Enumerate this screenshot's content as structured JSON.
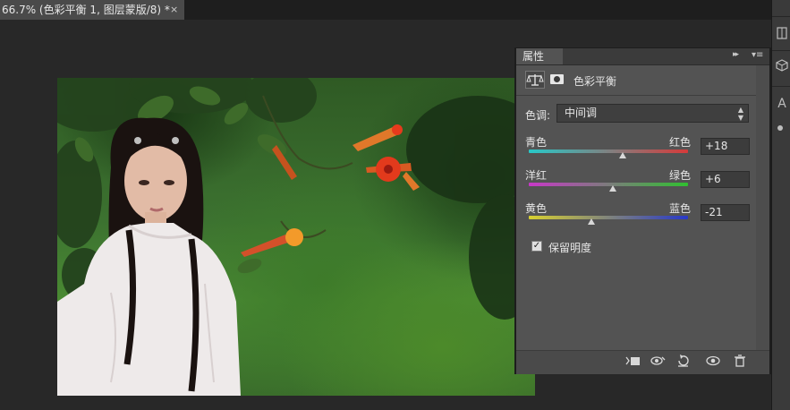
{
  "document_tab": {
    "title": "66.7% (色彩平衡 1, 图层蒙版/8) *",
    "close": "×"
  },
  "properties_panel": {
    "tab_label": "属性",
    "collapse_glyph": "▸▸",
    "menu_glyph": "▾≡",
    "adjustment_title": "色彩平衡",
    "tone_label": "色调:",
    "tone_value": "中间调",
    "sliders": [
      {
        "left": "青色",
        "right": "红色",
        "value": "+18",
        "fraction": 0.59,
        "gradient": [
          "#28c8c8",
          "#d63a3a"
        ]
      },
      {
        "left": "洋红",
        "right": "绿色",
        "value": "+6",
        "fraction": 0.53,
        "gradient": [
          "#c838c8",
          "#30c030"
        ]
      },
      {
        "left": "黄色",
        "right": "蓝色",
        "value": "-21",
        "fraction": 0.395,
        "gradient": [
          "#d8d030",
          "#2838c8"
        ]
      }
    ],
    "preserve_luminosity": {
      "label": "保留明度",
      "checked": true,
      "mark": "✓"
    }
  },
  "footer_icons": [
    "clip-to-layer-icon",
    "view-previous-state-icon",
    "reset-icon",
    "visibility-icon",
    "delete-icon"
  ],
  "right_dock": {
    "text_tool_glyph": "A"
  }
}
